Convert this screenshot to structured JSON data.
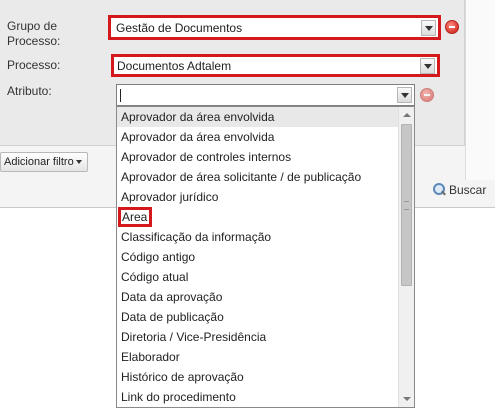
{
  "filters": {
    "grupo_label": "Grupo de Processo:",
    "grupo_value": "Gestão de Documentos",
    "processo_label": "Processo:",
    "processo_value": "Documentos Adtalem",
    "atributo_label": "Atributo:",
    "atributo_value": ""
  },
  "toolbar": {
    "add_filter_label": "Adicionar filtro",
    "search_label": "Buscar"
  },
  "dropdown": {
    "items": [
      "Aprovador da área envolvida",
      "Aprovador da área envolvida",
      "Aprovador de controles internos",
      "Aprovador de área solicitante / de publicação",
      "Aprovador jurídico",
      "Area",
      "Classificação da informação",
      "Código antigo",
      "Código atual",
      "Data da aprovação",
      "Data de publicação",
      "Diretoria / Vice-Presidência",
      "Elaborador",
      "Histórico de aprovação",
      "Link do procedimento"
    ]
  },
  "colors": {
    "highlight": "#d4181b",
    "remove_icon": "#d8372f"
  }
}
